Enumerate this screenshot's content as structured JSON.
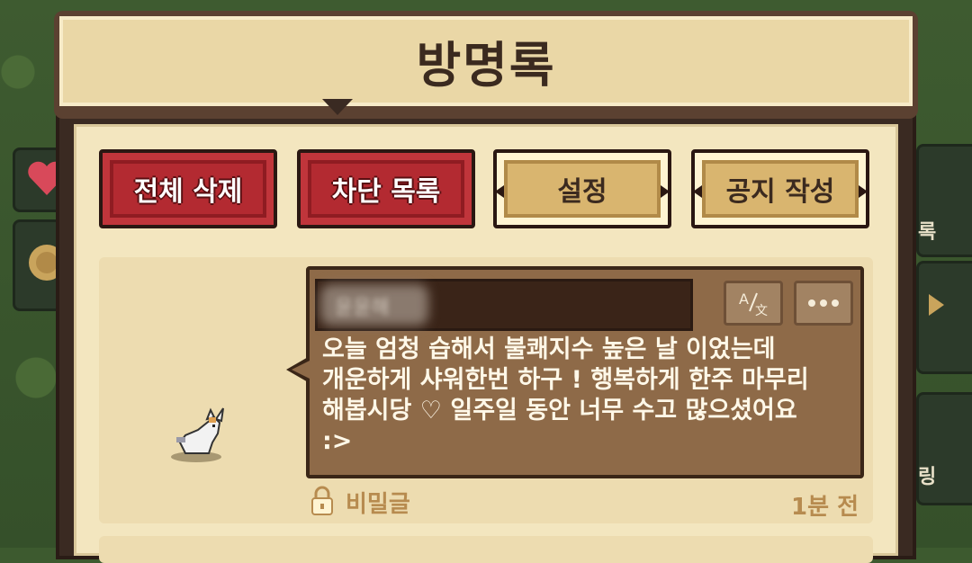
{
  "window": {
    "title": "방명록"
  },
  "toolbar": {
    "delete_all": "전체 삭제",
    "block_list": "차단 목록",
    "settings": "설정",
    "write_notice": "공지 작성"
  },
  "post": {
    "author": "윤윤해",
    "message": "오늘 엄청 습해서 불쾌지수 높은 날 이었는데\n개운하게 샤워한번 하구 ! 행복하게 한주 마무리\n해봅시당 ♡ 일주일 동안 너무 수고 많으셨어요\n:>",
    "secret_label": "비밀글",
    "time": "1분 전",
    "translate_icon": "translate-icon",
    "more_icon": "more-options-icon"
  },
  "side": {
    "right_labels": [
      "록",
      "링"
    ],
    "left_icons": [
      "heart-icon",
      "coin-icon"
    ]
  },
  "colors": {
    "red_button": "#c0353b",
    "tan_button": "#d9b56f",
    "bubble": "#8e6a48",
    "panel": "#f3e6bf",
    "accent_text": "#b78b4f"
  }
}
